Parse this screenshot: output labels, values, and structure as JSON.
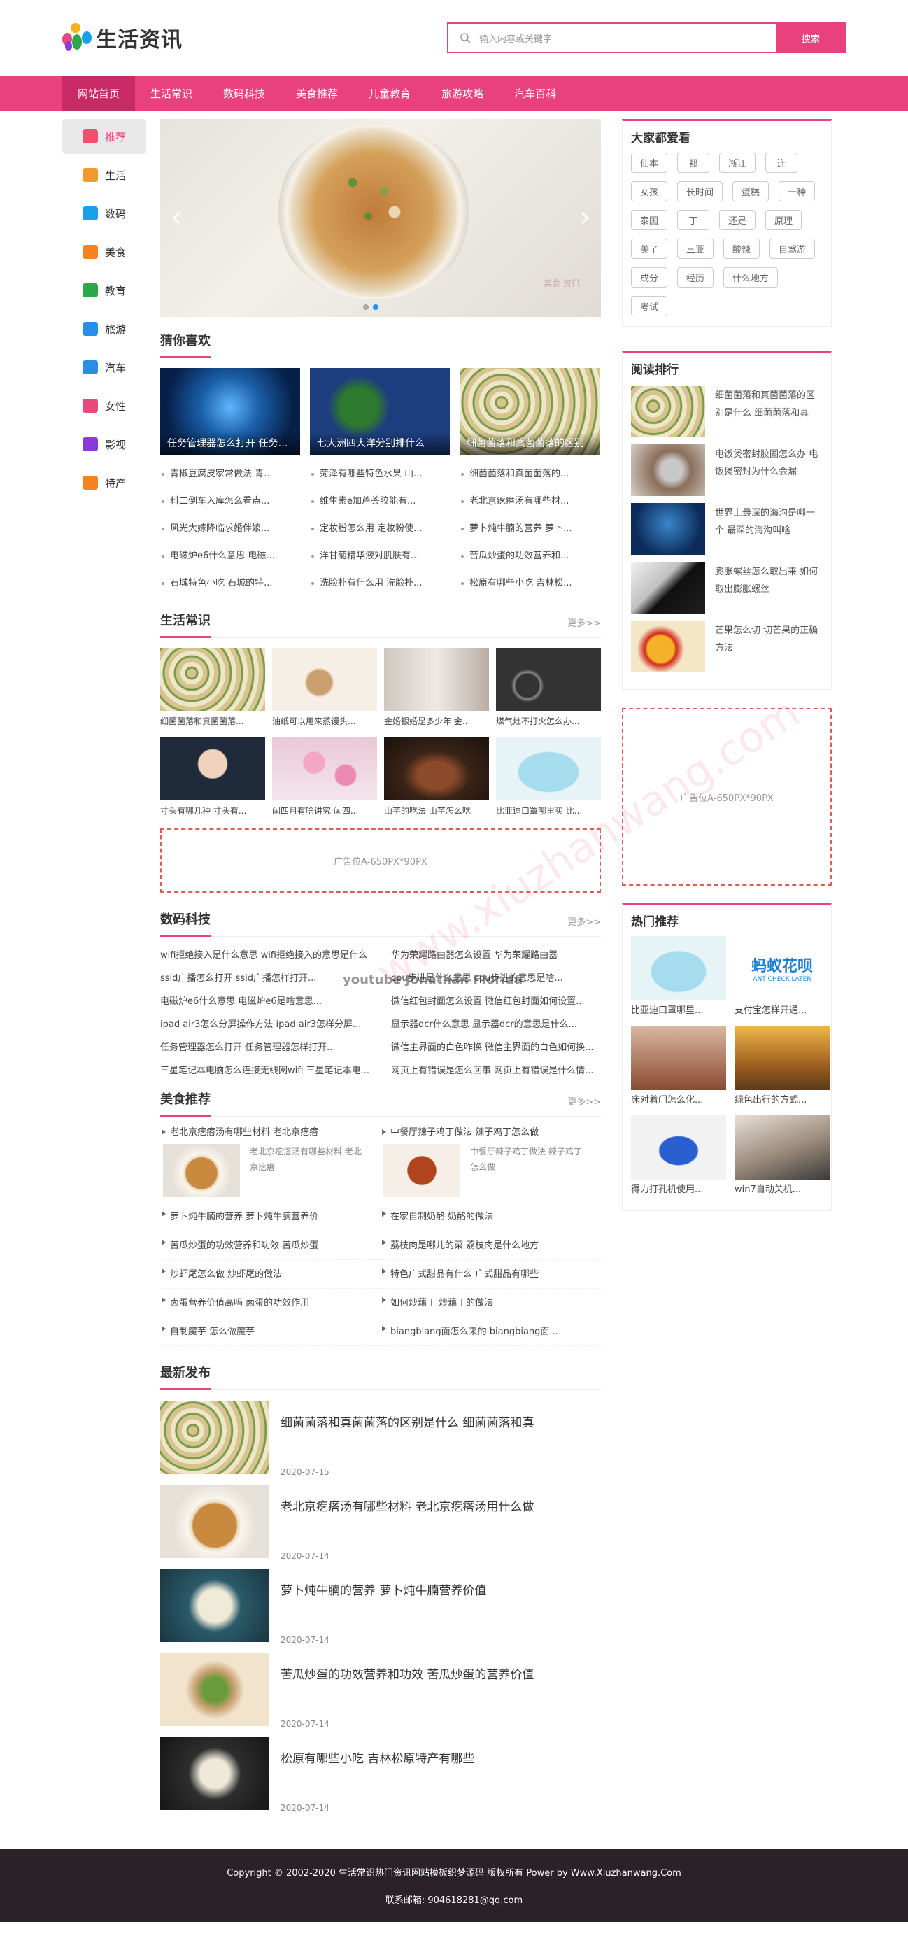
{
  "site": {
    "logo_text": "生活资讯",
    "brand_color": "#e8417e"
  },
  "search": {
    "placeholder": "输入内容或关键字",
    "button": "搜索"
  },
  "nav": [
    "网站首页",
    "生活常识",
    "数码科技",
    "美食推荐",
    "儿童教育",
    "旅游攻略",
    "汽车百科"
  ],
  "leftnav": [
    {
      "label": "推荐",
      "icon": "fire-icon",
      "color": "#f0506e"
    },
    {
      "label": "生活",
      "icon": "house-icon",
      "color": "#f39a2a"
    },
    {
      "label": "数码",
      "icon": "camera-icon",
      "color": "#1aa0e8"
    },
    {
      "label": "美食",
      "icon": "dish-icon",
      "color": "#f5821f"
    },
    {
      "label": "教育",
      "icon": "graduation-cap-icon",
      "color": "#2aa84a"
    },
    {
      "label": "旅游",
      "icon": "plane-icon",
      "color": "#2a8ee8"
    },
    {
      "label": "汽车",
      "icon": "car-icon",
      "color": "#2a8ee8"
    },
    {
      "label": "女性",
      "icon": "high-heel-icon",
      "color": "#e84a7e"
    },
    {
      "label": "影视",
      "icon": "play-icon",
      "color": "#8a3ad8"
    },
    {
      "label": "特产",
      "icon": "box-icon",
      "color": "#f5821f"
    }
  ],
  "banner": {
    "watermark": "美食·资讯",
    "slides": 2,
    "active_slide": 2
  },
  "guess": {
    "title": "猜你喜欢",
    "featured": [
      "任务管理器怎么打开 任务管理器",
      "七大洲四大洋分别排什么",
      "细菌菌落和真菌菌落的区别"
    ],
    "lists": [
      [
        "青椒豆腐皮家常做法 青...",
        "科二倒车入库怎么看点...",
        "风光大嫁降临求婚伴娘...",
        "电磁炉e6什么意思 电磁...",
        "石城特色小吃 石城的特..."
      ],
      [
        "菏泽有哪些特色水果 山...",
        "维生素e加芦荟胶能有...",
        "定妆粉怎么用 定妆粉使...",
        "洋甘菊精华液对肌肤有...",
        "洗脸扑有什么用 洗脸扑..."
      ],
      [
        "细菌菌落和真菌菌落的...",
        "老北京疙瘩汤有哪些材...",
        "萝卜炖牛腩的营养 萝卜...",
        "苦瓜炒蛋的功效营养和...",
        "松原有哪些小吃 吉林松..."
      ]
    ]
  },
  "life": {
    "title": "生活常识",
    "more": "更多>>",
    "items": [
      "细菌菌落和真菌菌落...",
      "油纸可以用来蒸馒头...",
      "金婚银婚是多少年 金...",
      "煤气灶不打火怎么办...",
      "寸头有哪几种 寸头有...",
      "闰四月有啥讲究 闰四...",
      "山芋的吃法 山芋怎么吃",
      "比亚迪口罩哪里买 比..."
    ]
  },
  "ad": {
    "left": "广告位A-650PX*90PX",
    "right": "广告位A-650PX*90PX"
  },
  "tech": {
    "title": "数码科技",
    "more": "更多>>",
    "items": [
      "wifi拒绝接入是什么意思 wifi拒绝接入的意思是什么",
      "华为荣耀路由器怎么设置 华为荣耀路由器",
      "ssid广播怎么打开 ssid广播怎样打开...",
      "cpu步进是什么意思 cpu步进的意思是啥...",
      "电磁炉e6什么意思 电磁炉e6是啥意思...",
      "微信红包封面怎么设置 微信红包封面如何设置...",
      "ipad air3怎么分屏操作方法 ipad air3怎样分屏...",
      "显示器dcr什么意思 显示器dcr的意思是什么...",
      "任务管理器怎么打开 任务管理器怎样打开...",
      "微信主界面的白色咋换 微信主界面的白色如何换...",
      "三星笔记本电脑怎么连接无线网wifi 三星笔记本电...",
      "网页上有错误是怎么回事 网页上有错误是什么情..."
    ]
  },
  "food": {
    "title": "美食推荐",
    "more": "更多>>",
    "featured": [
      {
        "title": "老北京疙瘩汤有哪些材料 老北京疙瘩",
        "desc": "老北京疙瘩汤有哪些材料 老北京疙瘩"
      },
      {
        "title": "中餐厅辣子鸡丁做法 辣子鸡丁怎么做",
        "desc": "中餐厅辣子鸡丁做法 辣子鸡丁怎么做"
      }
    ],
    "left_list": [
      "萝卜炖牛腩的营养 萝卜炖牛腩营养价",
      "苦瓜炒蛋的功效营养和功效 苦瓜炒蛋",
      "炒虾尾怎么做 炒虾尾的做法",
      "卤蛋营养价值高吗 卤蛋的功效作用",
      "自制魔芋 怎么做魔芋"
    ],
    "right_list": [
      "在家自制奶酪 奶酪的做法",
      "荔枝肉是哪儿的菜 荔枝肉是什么地方",
      "特色广式甜品有什么 广式甜品有哪些",
      "如何炒藕丁 炒藕丁的做法",
      "biangbiang面怎么来的 biangbiang面..."
    ]
  },
  "latest": {
    "title": "最新发布",
    "items": [
      {
        "title": "细菌菌落和真菌菌落的区别是什么 细菌菌落和真",
        "date": "2020-07-15"
      },
      {
        "title": "老北京疙瘩汤有哪些材料 老北京疙瘩汤用什么做",
        "date": "2020-07-14"
      },
      {
        "title": "萝卜炖牛腩的营养 萝卜炖牛腩营养价值",
        "date": "2020-07-14"
      },
      {
        "title": "苦瓜炒蛋的功效营养和功效 苦瓜炒蛋的营养价值",
        "date": "2020-07-14"
      },
      {
        "title": "松原有哪些小吃 吉林松原特产有哪些",
        "date": "2020-07-14"
      }
    ]
  },
  "tags": {
    "title": "大家都爱看",
    "items": [
      "仙本",
      "都",
      "浙江",
      "连",
      "女孩",
      "长时间",
      "蛋糕",
      "一种",
      "泰国",
      "丁",
      "还是",
      "原理",
      "美了",
      "三亚",
      "酸辣",
      "自驾游",
      "成分",
      "经历",
      "什么地方",
      "考试"
    ]
  },
  "ranking": {
    "title": "阅读排行",
    "items": [
      "细菌菌落和真菌菌落的区别是什么 细菌菌落和真",
      "电饭煲密封胶圈怎么办 电饭煲密封为什么会漏",
      "世界上最深的海沟是哪一个 最深的海沟叫啥",
      "膨胀螺丝怎么取出来 如何取出膨胀螺丝",
      "芒果怎么切 切芒果的正确方法"
    ]
  },
  "hot": {
    "title": "热门推荐",
    "items": [
      "比亚迪口罩哪里...",
      "支付宝怎样开通...",
      "床对着门怎么化...",
      "绿色出行的方式...",
      "得力打孔机使用...",
      "win7自动关机..."
    ],
    "ant_logo_text": "蚂蚁花呗",
    "ant_logo_sub": "ANT CHECK LATER"
  },
  "watermarks": [
    "www.xiuzhanwang.com",
    "youtube Jonathan Florida"
  ],
  "footer": {
    "copyright": "Copyright © 2002-2020 生活常识热门资讯网站模板织梦源码 版权所有 Power by Www.Xiuzhanwang.Com",
    "contact": "联系邮箱: 904618281@qq.com"
  }
}
